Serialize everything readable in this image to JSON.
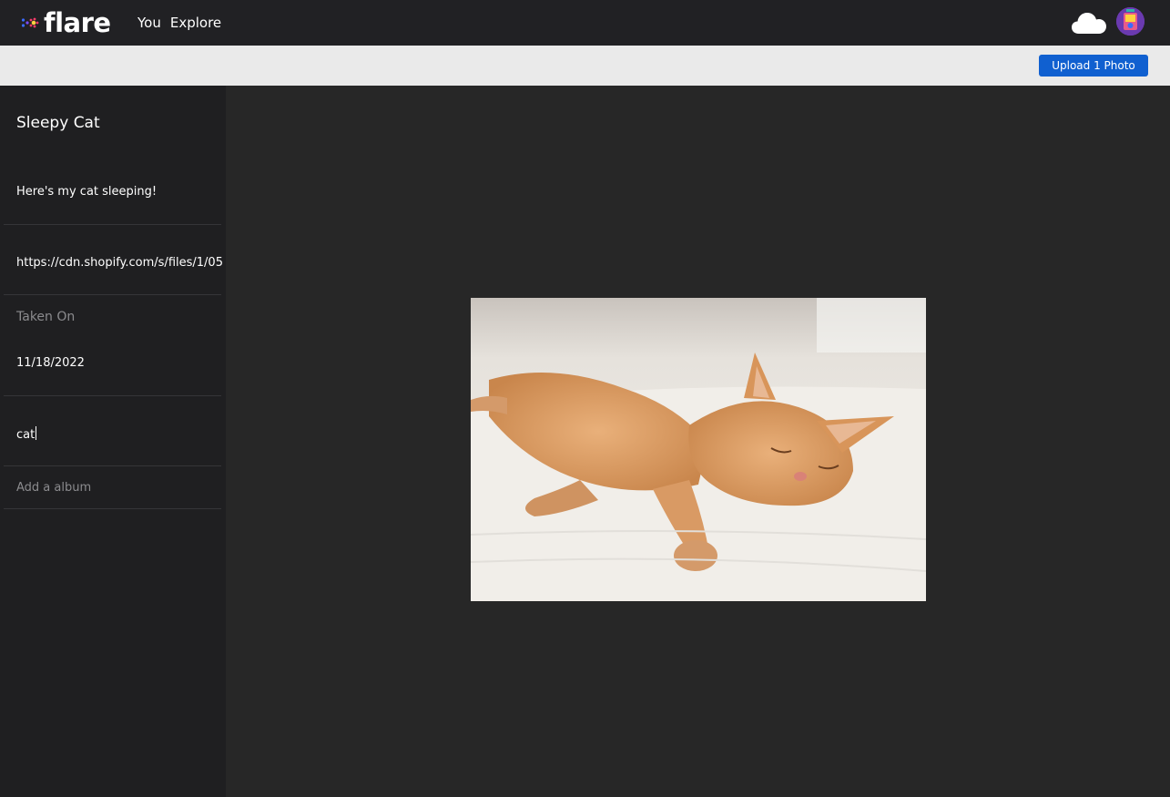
{
  "header": {
    "logo_text": "flare",
    "nav": [
      "You",
      "Explore"
    ]
  },
  "upload": {
    "button_label": "Upload 1 Photo"
  },
  "sidebar": {
    "title": "Sleepy Cat",
    "description": "Here's my cat sleeping!",
    "source_url": "https://cdn.shopify.com/s/files/1/05",
    "taken_on_label": "Taken On",
    "taken_on_value": "11/18/2022",
    "tags_value": "cat",
    "album_placeholder": "Add a album"
  },
  "colors": {
    "accent": "#1060d0",
    "topbar": "#212124",
    "sidebar": "#1f1f21",
    "canvas": "#272727"
  },
  "icons": [
    "flare-logo-icon",
    "cloud-icon",
    "avatar"
  ]
}
